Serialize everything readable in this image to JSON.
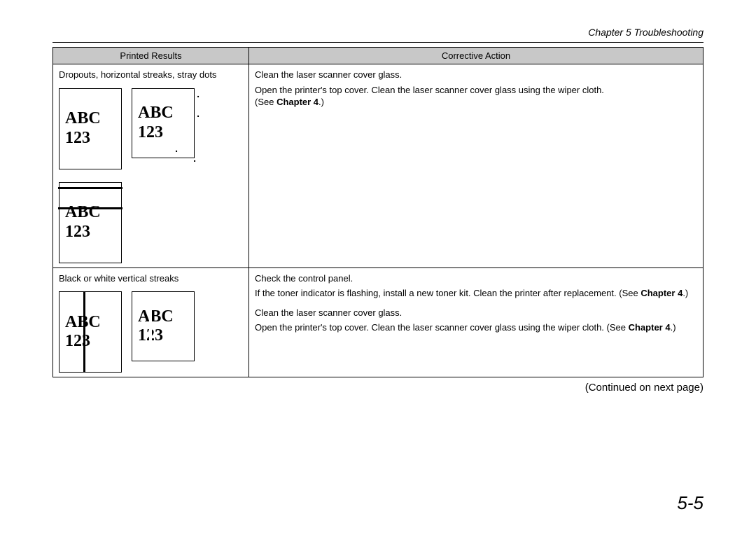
{
  "header": {
    "breadcrumb": "Chapter 5  Troubleshooting"
  },
  "table": {
    "col1": "Printed Results",
    "col2": "Corrective Action",
    "row1": {
      "problem": "Dropouts, horizontal streaks, stray dots",
      "action_head": "Clean the laser scanner cover glass.",
      "action_body": "Open the printer's top cover. Clean the laser scanner cover glass using the wiper cloth.",
      "action_ref_prefix": "(See ",
      "action_ref_bold": "Chapter 4",
      "action_ref_suffix": ".)"
    },
    "row2": {
      "problem": "Black or white vertical streaks",
      "a1_head": "Check the control panel.",
      "a1_body_prefix": "If the toner indicator is flashing, install a new toner kit. Clean the printer after replacement. (See ",
      "a1_body_bold": "Chapter 4",
      "a1_body_suffix": ".)",
      "a2_head": "Clean the laser scanner cover glass.",
      "a2_body_prefix": "Open the printer's top cover. Clean the laser scanner cover glass using the wiper cloth. (See ",
      "a2_body_bold": "Chapter 4",
      "a2_body_suffix": ".)"
    }
  },
  "sample_text": {
    "line1": "ABC",
    "line2": "123"
  },
  "footer": {
    "continued": "(Continued on next page)",
    "pagenum": "5-5"
  }
}
